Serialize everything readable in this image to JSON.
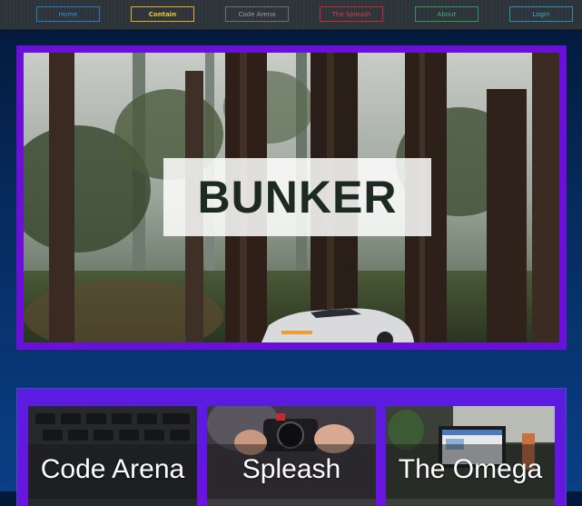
{
  "nav": {
    "home": "Home",
    "contain": "Contain",
    "code_arena": "Code Arena",
    "spleash": "The Spleash",
    "about": "About",
    "login": "Login"
  },
  "hero": {
    "title": "BUNKER",
    "image": "forest-with-car-photo"
  },
  "cards": [
    {
      "label": "Code Arena",
      "image": "keyboard-photo"
    },
    {
      "label": "Spleash",
      "image": "camera-photo"
    },
    {
      "label": "The Omega",
      "image": "desk-monitor-photo"
    }
  ],
  "colors": {
    "frame_accent": "#6a10d8",
    "nav_home": "#3a8ee0",
    "nav_contain": "#f2c534",
    "nav_spleash": "#e03848",
    "nav_about": "#38b870",
    "nav_login": "#3ab0d8"
  }
}
